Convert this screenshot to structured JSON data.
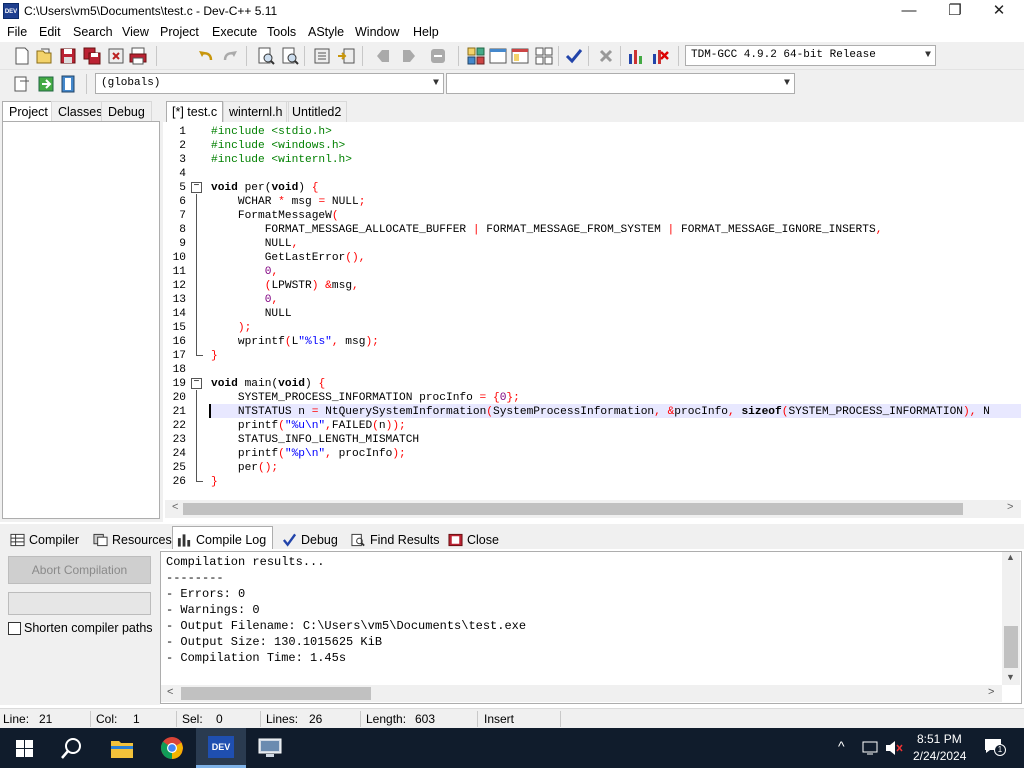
{
  "window": {
    "title": "C:\\Users\\vm5\\Documents\\test.c - Dev-C++ 5.11",
    "app_icon_text": "DEV",
    "min_glyph": "—",
    "max_glyph": "❐",
    "close_glyph": "✕"
  },
  "menu": [
    "File",
    "Edit",
    "Search",
    "View",
    "Project",
    "Execute",
    "Tools",
    "AStyle",
    "Window",
    "Help"
  ],
  "toolbar": {
    "compiler_select": "TDM-GCC 4.9.2 64-bit Release",
    "scope_select": "(globals)",
    "member_select": ""
  },
  "left_panel": {
    "tabs": [
      "Project",
      "Classes",
      "Debug"
    ]
  },
  "editor_tabs": [
    "[*] test.c",
    "winternl.h",
    "Untitled2"
  ],
  "code_lines": [
    {
      "n": "1",
      "segs": [
        [
          "pp",
          "#include <stdio.h>"
        ]
      ]
    },
    {
      "n": "2",
      "segs": [
        [
          "pp",
          "#include <windows.h>"
        ]
      ]
    },
    {
      "n": "3",
      "segs": [
        [
          "pp",
          "#include <winternl.h>"
        ]
      ]
    },
    {
      "n": "4",
      "segs": []
    },
    {
      "n": "5",
      "segs": [
        [
          "kw",
          "void"
        ],
        [
          "t",
          " per("
        ],
        [
          "kw",
          "void"
        ],
        [
          "t",
          ") "
        ],
        [
          "sym",
          "{"
        ]
      ]
    },
    {
      "n": "6",
      "segs": [
        [
          "t",
          "    WCHAR "
        ],
        [
          "sym",
          "*"
        ],
        [
          "t",
          " msg "
        ],
        [
          "sym",
          "="
        ],
        [
          "t",
          " NULL"
        ],
        [
          "sym",
          ";"
        ]
      ]
    },
    {
      "n": "7",
      "segs": [
        [
          "t",
          "    FormatMessageW"
        ],
        [
          "sym",
          "("
        ]
      ]
    },
    {
      "n": "8",
      "segs": [
        [
          "t",
          "        FORMAT_MESSAGE_ALLOCATE_BUFFER "
        ],
        [
          "sym",
          "|"
        ],
        [
          "t",
          " FORMAT_MESSAGE_FROM_SYSTEM "
        ],
        [
          "sym",
          "|"
        ],
        [
          "t",
          " FORMAT_MESSAGE_IGNORE_INSERTS"
        ],
        [
          "sym",
          ","
        ]
      ]
    },
    {
      "n": "9",
      "segs": [
        [
          "t",
          "        NULL"
        ],
        [
          "sym",
          ","
        ]
      ]
    },
    {
      "n": "10",
      "segs": [
        [
          "t",
          "        GetLastError"
        ],
        [
          "sym",
          "(),"
        ]
      ]
    },
    {
      "n": "11",
      "segs": [
        [
          "t",
          "        "
        ],
        [
          "num",
          "0"
        ],
        [
          "sym",
          ","
        ]
      ]
    },
    {
      "n": "12",
      "segs": [
        [
          "t",
          "        "
        ],
        [
          "sym",
          "("
        ],
        [
          "t",
          "LPWSTR"
        ],
        [
          "sym",
          ")"
        ],
        [
          "t",
          " "
        ],
        [
          "sym",
          "&"
        ],
        [
          "t",
          "msg"
        ],
        [
          "sym",
          ","
        ]
      ]
    },
    {
      "n": "13",
      "segs": [
        [
          "t",
          "        "
        ],
        [
          "num",
          "0"
        ],
        [
          "sym",
          ","
        ]
      ]
    },
    {
      "n": "14",
      "segs": [
        [
          "t",
          "        NULL"
        ]
      ]
    },
    {
      "n": "15",
      "segs": [
        [
          "t",
          "    "
        ],
        [
          "sym",
          ");"
        ]
      ]
    },
    {
      "n": "16",
      "segs": [
        [
          "t",
          "    wprintf"
        ],
        [
          "sym",
          "("
        ],
        [
          "t",
          "L"
        ],
        [
          "str",
          "\"%ls\""
        ],
        [
          "sym",
          ","
        ],
        [
          "t",
          " msg"
        ],
        [
          "sym",
          ");"
        ]
      ]
    },
    {
      "n": "17",
      "segs": [
        [
          "sym",
          "}"
        ]
      ]
    },
    {
      "n": "18",
      "segs": []
    },
    {
      "n": "19",
      "segs": [
        [
          "kw",
          "void"
        ],
        [
          "t",
          " main("
        ],
        [
          "kw",
          "void"
        ],
        [
          "t",
          ") "
        ],
        [
          "sym",
          "{"
        ]
      ]
    },
    {
      "n": "20",
      "segs": [
        [
          "t",
          "    SYSTEM_PROCESS_INFORMATION procInfo "
        ],
        [
          "sym",
          "="
        ],
        [
          "t",
          " "
        ],
        [
          "sym",
          "{"
        ],
        [
          "num",
          "0"
        ],
        [
          "sym",
          "};"
        ]
      ]
    },
    {
      "n": "21",
      "segs": [
        [
          "t",
          "    NTSTATUS n "
        ],
        [
          "sym",
          "="
        ],
        [
          "t",
          " NtQuerySystemInformation"
        ],
        [
          "sym",
          "("
        ],
        [
          "t",
          "SystemProcessInformation"
        ],
        [
          "sym",
          ","
        ],
        [
          "t",
          " "
        ],
        [
          "sym",
          "&"
        ],
        [
          "t",
          "procInfo"
        ],
        [
          "sym",
          ","
        ],
        [
          "t",
          " "
        ],
        [
          "kw",
          "sizeof"
        ],
        [
          "sym",
          "("
        ],
        [
          "t",
          "SYSTEM_PROCESS_INFORMATION"
        ],
        [
          "sym",
          "),"
        ],
        [
          "t",
          " N"
        ]
      ]
    },
    {
      "n": "22",
      "segs": [
        [
          "t",
          "    printf"
        ],
        [
          "sym",
          "("
        ],
        [
          "str",
          "\"%u\\n\""
        ],
        [
          "sym",
          ","
        ],
        [
          "t",
          "FAILED"
        ],
        [
          "sym",
          "("
        ],
        [
          "t",
          "n"
        ],
        [
          "sym",
          "));"
        ]
      ]
    },
    {
      "n": "23",
      "segs": [
        [
          "t",
          "    STATUS_INFO_LENGTH_MISMATCH"
        ]
      ]
    },
    {
      "n": "24",
      "segs": [
        [
          "t",
          "    printf"
        ],
        [
          "sym",
          "("
        ],
        [
          "str",
          "\"%p\\n\""
        ],
        [
          "sym",
          ","
        ],
        [
          "t",
          " procInfo"
        ],
        [
          "sym",
          ");"
        ]
      ]
    },
    {
      "n": "25",
      "segs": [
        [
          "t",
          "    per"
        ],
        [
          "sym",
          "();"
        ]
      ]
    },
    {
      "n": "26",
      "segs": [
        [
          "sym",
          "}"
        ]
      ]
    }
  ],
  "bottom_tabs": [
    "Compiler",
    "Resources",
    "Compile Log",
    "Debug",
    "Find Results",
    "Close"
  ],
  "compile_panel": {
    "abort_label": "Abort Compilation",
    "shorten_label": "Shorten compiler paths",
    "shorten_checked": false,
    "log_lines": [
      "Compilation results...",
      "--------",
      "- Errors: 0",
      "- Warnings: 0",
      "- Output Filename: C:\\Users\\vm5\\Documents\\test.exe",
      "- Output Size: 130.1015625 KiB",
      "- Compilation Time: 1.45s"
    ]
  },
  "status": {
    "line_label": "Line:",
    "line_value": "21",
    "col_label": "Col:",
    "col_value": "1",
    "sel_label": "Sel:",
    "sel_value": "0",
    "lines_label": "Lines:",
    "lines_value": "26",
    "length_label": "Length:",
    "length_value": "603",
    "mode": "Insert"
  },
  "taskbar": {
    "time": "8:51 PM",
    "date": "2/24/2024",
    "dev_label": "DEV",
    "notif_count": "1"
  },
  "colors": {
    "preprocessor": "#008000",
    "string": "#0000ff",
    "symbol": "#ff0000",
    "number": "#800080",
    "current_line": "#e8e8ff",
    "taskbar": "#101c2c"
  }
}
